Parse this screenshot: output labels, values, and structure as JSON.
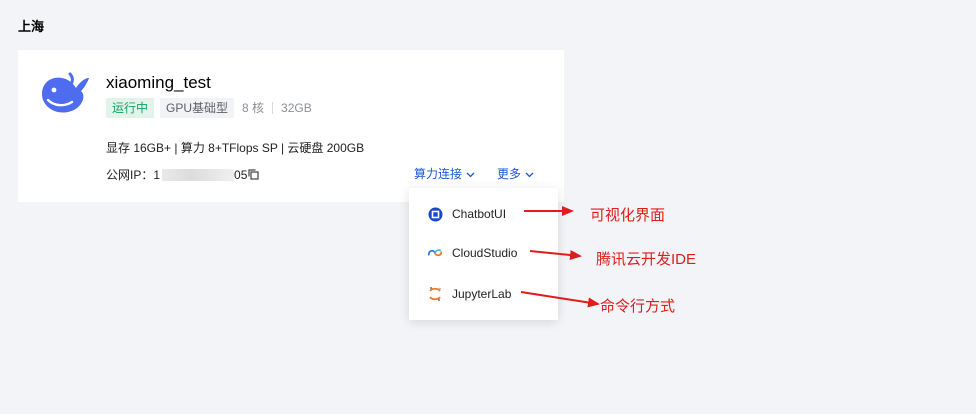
{
  "region": {
    "title": "上海"
  },
  "instance": {
    "name": "xiaoming_test",
    "tags": {
      "status": "运行中",
      "type": "GPU基础型",
      "cores": "8 核",
      "memory": "32GB"
    },
    "specs": "显存 16GB+ | 算力 8+TFlops SP | 云硬盘 200GB",
    "ip": {
      "label": "公网IP：",
      "prefix": "1",
      "suffix": "05"
    },
    "actions": {
      "connect": "算力连接",
      "more": "更多"
    }
  },
  "dropdown": {
    "items": [
      {
        "label": "ChatbotUI",
        "icon": "chatbot-ui-icon"
      },
      {
        "label": "CloudStudio",
        "icon": "cloud-studio-icon"
      },
      {
        "label": "JupyterLab",
        "icon": "jupyter-icon"
      }
    ]
  },
  "annotations": {
    "chatbot": "可视化界面",
    "cloudstudio": "腾讯云开发IDE",
    "jupyter": "命令行方式"
  },
  "colors": {
    "accent": "#1b58d6",
    "running": "#14a263",
    "annotation": "#e11c1c"
  }
}
